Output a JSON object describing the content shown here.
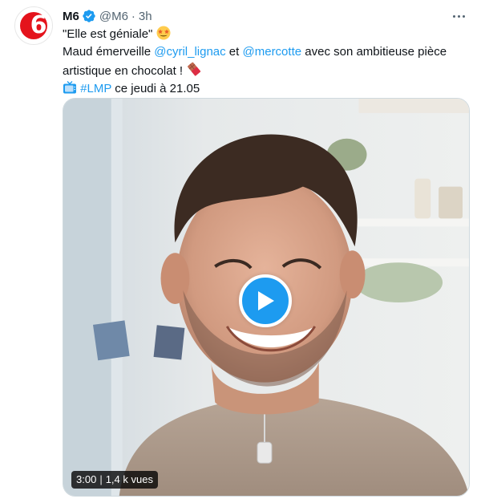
{
  "account": {
    "name": "M6",
    "handle": "@M6",
    "separator": "·",
    "time": "3h",
    "avatar_label": "6",
    "verified": true
  },
  "tweet": {
    "line1": "\"Elle est géniale\"",
    "line1_emoji": "star-struck-emoji",
    "line2_prefix": "Maud émerveille ",
    "mention1": "@cyril_lignac",
    "line2_mid": " et ",
    "mention2": "@mercotte",
    "line2_suffix": " avec son ambitieuse pièce",
    "line3": "artistique en chocolat ! ",
    "line3_emoji": "chocolate-bar-emoji",
    "line4_emoji": "tv-emoji",
    "hashtag": "#LMP",
    "line4_suffix": " ce jeudi à 21.05"
  },
  "video": {
    "duration": "3:00",
    "views": "1,4 k vues",
    "play_icon": "play-icon"
  },
  "colors": {
    "link": "#1d9bf0",
    "brand": "#e4131c",
    "muted": "#536471"
  }
}
